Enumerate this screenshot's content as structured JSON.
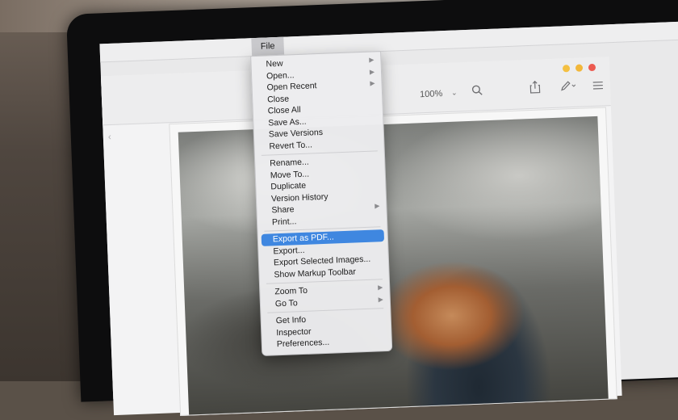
{
  "menubar": {
    "active_menu": "File"
  },
  "toolbar": {
    "zoom_level": "100%",
    "zoom_caret_icon": "chevron-down-icon",
    "icons": [
      "search-icon",
      "share-icon",
      "markup-pen-icon",
      "sidebar-list-icon"
    ]
  },
  "window_controls": [
    "minimize",
    "zoom",
    "close"
  ],
  "menu": {
    "groups": [
      [
        {
          "label": "New",
          "submenu": true
        },
        {
          "label": "Open...",
          "submenu": true
        },
        {
          "label": "Open Recent",
          "submenu": true
        },
        {
          "label": "Close"
        },
        {
          "label": "Close All"
        },
        {
          "label": "Save As..."
        },
        {
          "label": "Save Versions"
        },
        {
          "label": "Revert To..."
        }
      ],
      [
        {
          "label": "Rename..."
        },
        {
          "label": "Move To..."
        },
        {
          "label": "Duplicate"
        },
        {
          "label": "Version History"
        },
        {
          "label": "Share",
          "submenu": true
        },
        {
          "label": "Print..."
        }
      ],
      [
        {
          "label": "Export as PDF...",
          "highlighted": true
        },
        {
          "label": "Export..."
        },
        {
          "label": "Export Selected Images..."
        },
        {
          "label": "Show Markup Toolbar"
        }
      ],
      [
        {
          "label": "Zoom To",
          "submenu": true
        },
        {
          "label": "Go To",
          "submenu": true
        }
      ],
      [
        {
          "label": "Get Info"
        },
        {
          "label": "Inspector"
        },
        {
          "label": "Preferences..."
        }
      ]
    ]
  },
  "colors": {
    "highlight": "#3f87e0",
    "close": "#ec5a50",
    "minimize": "#f4c042"
  }
}
